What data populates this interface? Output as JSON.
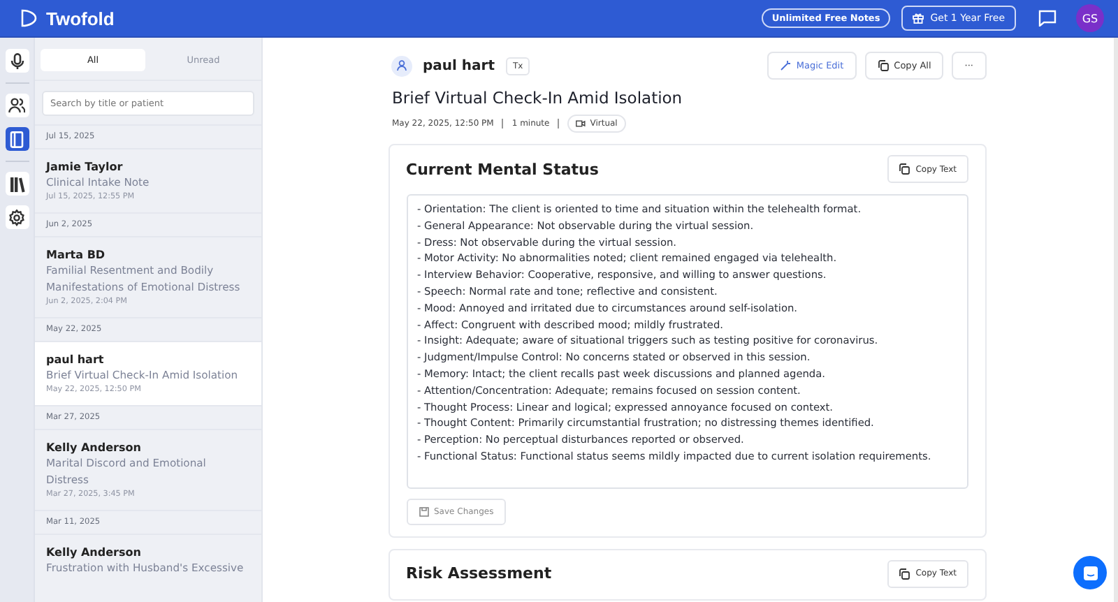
{
  "header": {
    "app_name": "Twofold",
    "promo_badge": "Unlimited Free Notes",
    "offer_button": "Get 1 Year Free",
    "avatar_initials": "GS"
  },
  "rail": [
    {
      "selected": false
    },
    {
      "selected": false
    },
    {
      "selected": true
    },
    {
      "selected": false
    },
    {
      "selected": false
    }
  ],
  "filter_tabs": [
    {
      "label": "All",
      "selected": true
    },
    {
      "label": "Unread",
      "selected": false
    }
  ],
  "search": {
    "placeholder": "Search by title or patient"
  },
  "note_groups": [
    {
      "date": "Jul 15, 2025",
      "notes": [
        {
          "patient": "Jamie Taylor",
          "title": "Clinical Intake Note",
          "timestamp": "Jul 15, 2025, 12:55 PM",
          "selected": false
        }
      ]
    },
    {
      "date": "Jun 2, 2025",
      "notes": [
        {
          "patient": "Marta BD",
          "title": "Familial Resentment and Bodily Manifestations of Emotional Distress",
          "timestamp": "Jun 2, 2025, 2:04 PM",
          "selected": false
        }
      ]
    },
    {
      "date": "May 22, 2025",
      "notes": [
        {
          "patient": "paul hart",
          "title": "Brief Virtual Check-In Amid Isolation",
          "timestamp": "May 22, 2025, 12:50 PM",
          "selected": true
        }
      ]
    },
    {
      "date": "Mar 27, 2025",
      "notes": [
        {
          "patient": "Kelly Anderson",
          "title": "Marital Discord and Emotional Distress",
          "timestamp": "Mar 27, 2025, 3:45 PM",
          "selected": false
        }
      ]
    },
    {
      "date": "Mar 11, 2025",
      "notes": [
        {
          "patient": "Kelly Anderson",
          "title": "Frustration with Husband's Excessive",
          "selected": false
        }
      ]
    }
  ],
  "note": {
    "patient": "paul hart",
    "tx_badge": "Tx",
    "actions": [
      "Magic Edit",
      "Copy All",
      "···"
    ],
    "title": "Brief Virtual Check-In Amid Isolation",
    "datetime": "May 22, 2025, 12:50 PM",
    "duration": "1 minute",
    "mode": "Virtual",
    "sections": [
      {
        "heading": "Current Mental Status",
        "copy_button": "Copy Text",
        "save_button": "Save Changes",
        "lines": [
          "- Orientation: The client is oriented to time and situation within the telehealth format.",
          "- General Appearance: Not observable during the virtual session.",
          "- Dress: Not observable during the virtual session.",
          "- Motor Activity: No abnormalities noted; client remained engaged via telehealth.",
          "- Interview Behavior: Cooperative, responsive, and willing to answer questions.",
          "- Speech: Normal rate and tone; reflective and consistent.",
          "- Mood: Annoyed and irritated due to circumstances around self-isolation.",
          "- Affect: Congruent with described mood; mildly frustrated.",
          "- Insight: Adequate; aware of situational triggers such as testing positive for coronavirus.",
          "- Judgment/Impulse Control: No concerns stated or observed in this session.",
          "- Memory: Intact; the client recalls past week discussions and planned agenda.",
          "- Attention/Concentration: Adequate; remains focused on session content.",
          "- Thought Process: Linear and logical; expressed annoyance focused on context.",
          "- Thought Content: Primarily circumstantial frustration; no distressing themes identified.",
          "- Perception: No perceptual disturbances reported or observed.",
          "- Functional Status: Functional status seems mildly impacted due to current isolation requirements."
        ]
      },
      {
        "heading": "Risk Assessment",
        "copy_button": "Copy Text"
      }
    ]
  }
}
